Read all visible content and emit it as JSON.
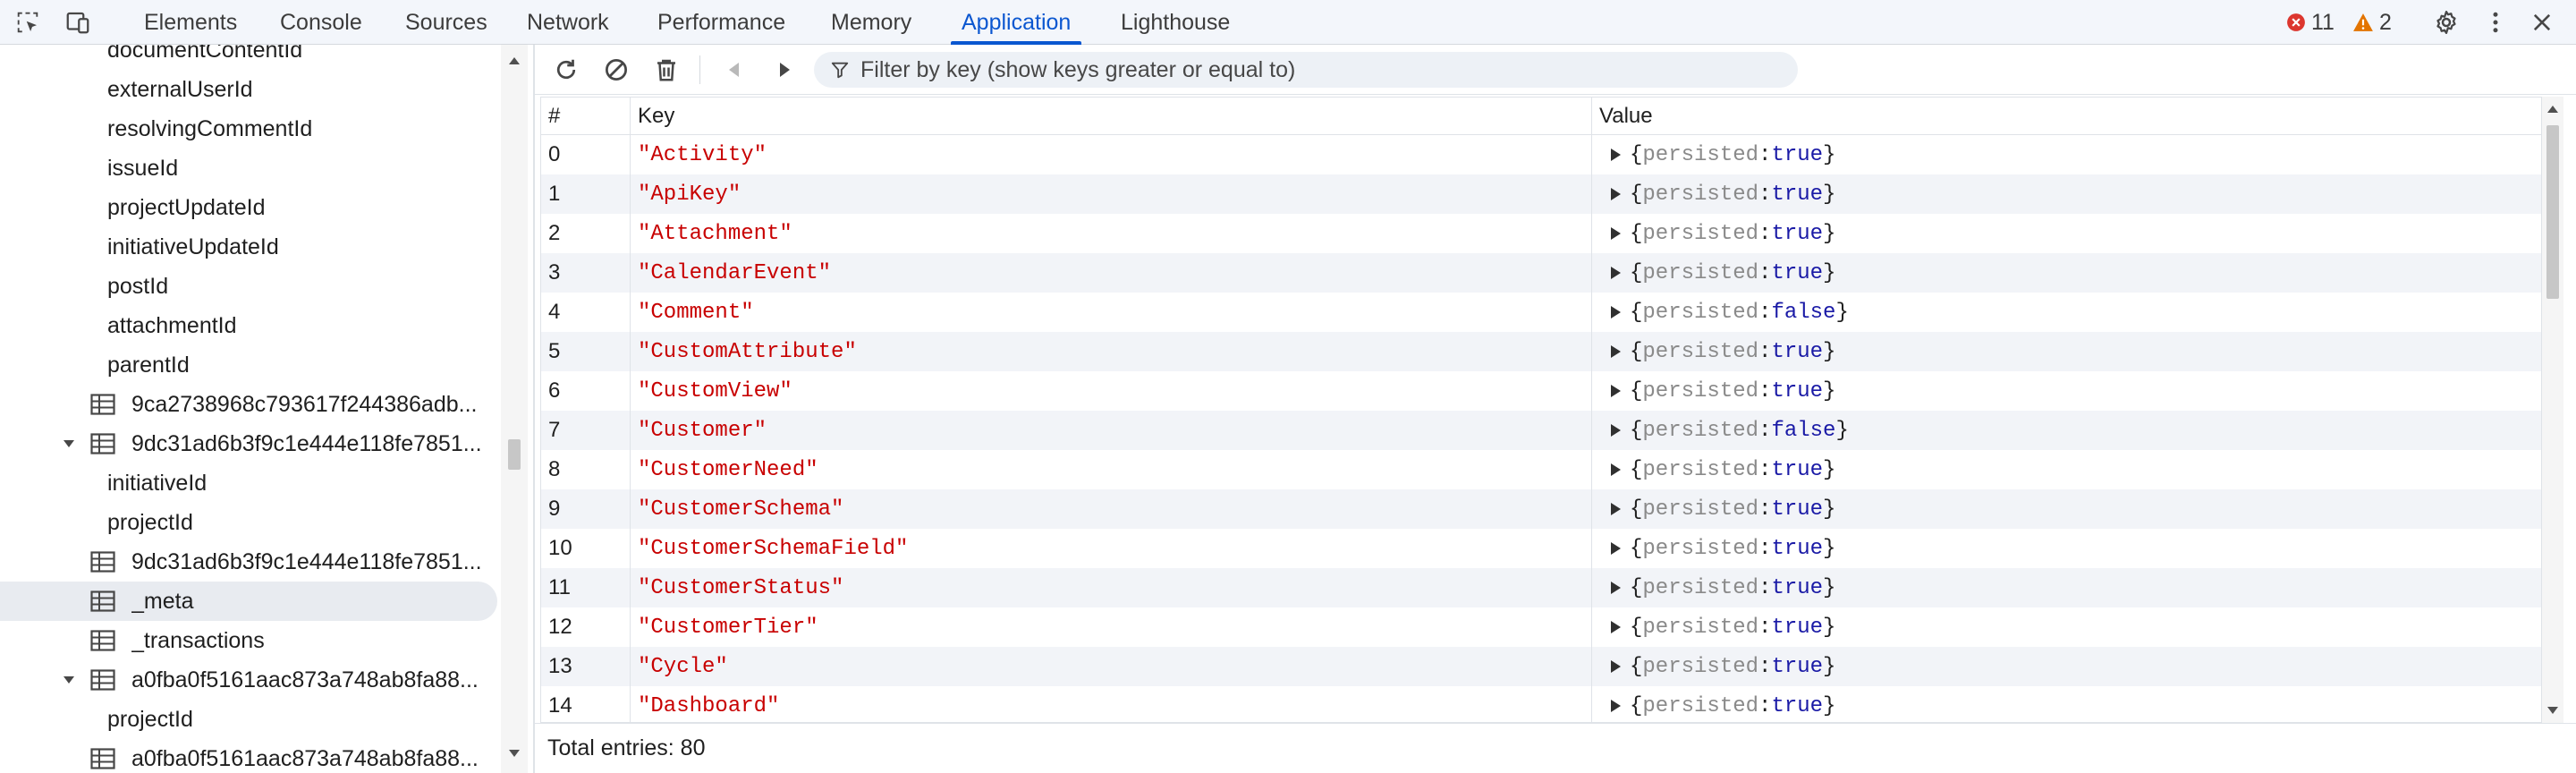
{
  "tabs": [
    {
      "label": "Elements"
    },
    {
      "label": "Console"
    },
    {
      "label": "Sources"
    },
    {
      "label": "Network"
    },
    {
      "label": "Performance"
    },
    {
      "label": "Memory"
    },
    {
      "label": "Application"
    },
    {
      "label": "Lighthouse"
    }
  ],
  "active_tab": "Application",
  "status": {
    "errors": "11",
    "warnings": "2"
  },
  "sidebar": {
    "items": [
      {
        "label": "documentContentId",
        "kind": "index"
      },
      {
        "label": "externalUserId",
        "kind": "index"
      },
      {
        "label": "resolvingCommentId",
        "kind": "index"
      },
      {
        "label": "issueId",
        "kind": "index"
      },
      {
        "label": "projectUpdateId",
        "kind": "index"
      },
      {
        "label": "initiativeUpdateId",
        "kind": "index"
      },
      {
        "label": "postId",
        "kind": "index"
      },
      {
        "label": "attachmentId",
        "kind": "index"
      },
      {
        "label": "parentId",
        "kind": "index"
      },
      {
        "label": "9ca2738968c793617f244386adb...",
        "kind": "store"
      },
      {
        "label": "9dc31ad6b3f9c1e444e118fe7851...",
        "kind": "store-expanded"
      },
      {
        "label": "initiativeId",
        "kind": "index"
      },
      {
        "label": "projectId",
        "kind": "index"
      },
      {
        "label": "9dc31ad6b3f9c1e444e118fe7851...",
        "kind": "store"
      },
      {
        "label": "_meta",
        "kind": "store-selected"
      },
      {
        "label": "_transactions",
        "kind": "store"
      },
      {
        "label": "a0fba0f5161aac873a748ab8fa88...",
        "kind": "store-expanded"
      },
      {
        "label": "projectId",
        "kind": "index"
      },
      {
        "label": "a0fba0f5161aac873a748ab8fa88...",
        "kind": "store"
      }
    ]
  },
  "toolbar": {
    "filter_placeholder": "Filter by key (show keys greater or equal to)"
  },
  "table": {
    "columns": [
      "#",
      "Key",
      "Value"
    ],
    "value_key": "persisted",
    "rows": [
      {
        "n": "0",
        "key": "\"Activity\"",
        "val": "true"
      },
      {
        "n": "1",
        "key": "\"ApiKey\"",
        "val": "true"
      },
      {
        "n": "2",
        "key": "\"Attachment\"",
        "val": "true"
      },
      {
        "n": "3",
        "key": "\"CalendarEvent\"",
        "val": "true"
      },
      {
        "n": "4",
        "key": "\"Comment\"",
        "val": "false"
      },
      {
        "n": "5",
        "key": "\"CustomAttribute\"",
        "val": "true"
      },
      {
        "n": "6",
        "key": "\"CustomView\"",
        "val": "true"
      },
      {
        "n": "7",
        "key": "\"Customer\"",
        "val": "false"
      },
      {
        "n": "8",
        "key": "\"CustomerNeed\"",
        "val": "true"
      },
      {
        "n": "9",
        "key": "\"CustomerSchema\"",
        "val": "true"
      },
      {
        "n": "10",
        "key": "\"CustomerSchemaField\"",
        "val": "true"
      },
      {
        "n": "11",
        "key": "\"CustomerStatus\"",
        "val": "true"
      },
      {
        "n": "12",
        "key": "\"CustomerTier\"",
        "val": "true"
      },
      {
        "n": "13",
        "key": "\"Cycle\"",
        "val": "true"
      },
      {
        "n": "14",
        "key": "\"Dashboard\"",
        "val": "true"
      }
    ]
  },
  "footer": {
    "total": "Total entries: 80"
  },
  "colors": {
    "accent": "#0b57d0",
    "error": "#dc362e",
    "warning": "#e37400",
    "key_string": "#c80000",
    "value_bool": "#1a1aa6"
  }
}
